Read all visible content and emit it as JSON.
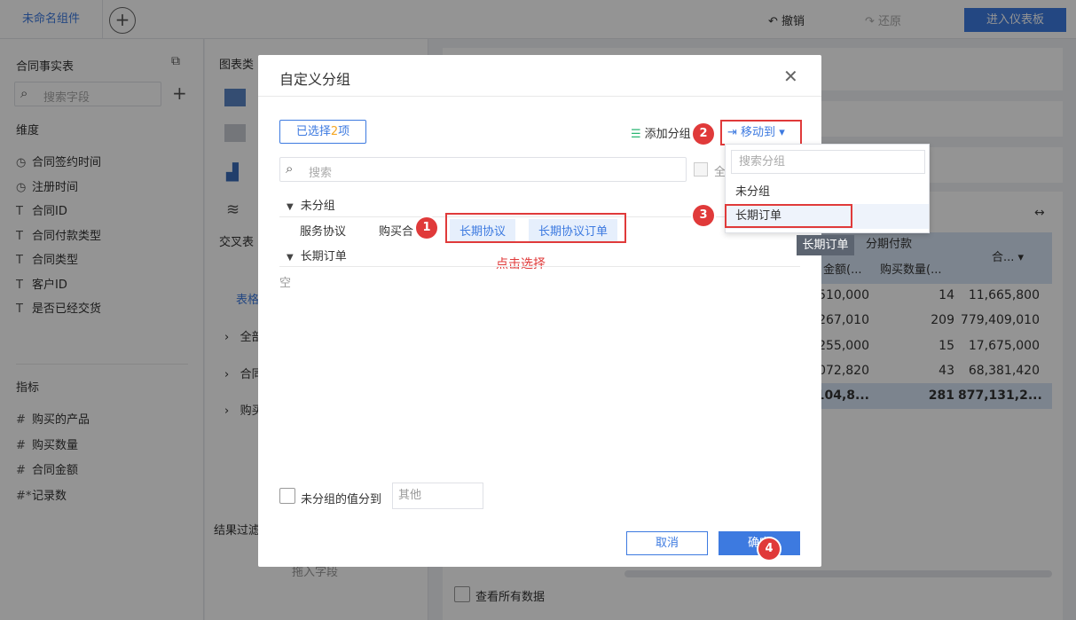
{
  "topbar": {
    "component_name": "未命名组件",
    "add_label": "+",
    "undo_label": "撤销",
    "redo_label": "还原",
    "enter_dashboard_label": "进入仪表板"
  },
  "left_panel": {
    "title": "合同事实表",
    "search_placeholder": "搜索字段",
    "dimension_header": "维度",
    "dimensions": [
      {
        "icon": "clock-icon",
        "glyph": "◷",
        "label": "合同签约时间"
      },
      {
        "icon": "clock-icon",
        "glyph": "◷",
        "label": "注册时间"
      },
      {
        "icon": "text-field-icon",
        "glyph": "T",
        "label": "合同ID"
      },
      {
        "icon": "text-field-icon",
        "glyph": "T",
        "label": "合同付款类型"
      },
      {
        "icon": "text-field-icon",
        "glyph": "T",
        "label": "合同类型"
      },
      {
        "icon": "text-field-icon",
        "glyph": "T",
        "label": "客户ID"
      },
      {
        "icon": "text-field-icon",
        "glyph": "T",
        "label": "是否已经交货"
      }
    ],
    "metric_header": "指标",
    "metrics": [
      {
        "icon": "number-field-icon",
        "glyph": "#",
        "label": "购买的产品"
      },
      {
        "icon": "number-field-icon",
        "glyph": "#",
        "label": "购买数量"
      },
      {
        "icon": "number-field-icon",
        "glyph": "#",
        "label": "合同金额"
      },
      {
        "icon": "record-count-icon",
        "glyph": "#*",
        "label": "记录数"
      }
    ]
  },
  "middle_panel": {
    "chart_type_label": "图表类",
    "cross_table_label": "交叉表",
    "table_label": "表格",
    "rows": [
      "全部",
      "合同",
      "购买"
    ],
    "result_filter_label": "结果过滤",
    "drop_field_label": "拖入字段"
  },
  "background_table": {
    "header_group": "分期付款",
    "columns": [
      "金额(...",
      "购买数量(...",
      "合..."
    ],
    "rows": [
      [
        ",510,000",
        "14",
        "11,665,800"
      ],
      [
        ",267,010",
        "209",
        "779,409,010"
      ],
      [
        ",255,000",
        "15",
        "17,675,000"
      ],
      [
        ",072,820",
        "43",
        "68,381,420"
      ]
    ],
    "total_row": [
      "104,8...",
      "281",
      "877,131,2..."
    ],
    "view_all_label": "查看所有数据"
  },
  "dialog": {
    "title": "自定义分组",
    "selected_prefix": "已选择",
    "selected_count": "2",
    "selected_suffix": "项",
    "add_group_label": "添加分组",
    "move_to_label": "移动到",
    "search_placeholder": "搜索",
    "select_all_label": "全",
    "groups": [
      {
        "name": "未分组",
        "items": [
          "服务协议",
          "购买合",
          "长期协议",
          "长期协议订单"
        ]
      },
      {
        "name": "长期订单",
        "items": []
      }
    ],
    "empty_label": "空",
    "hint_label": "点击选择",
    "ungroup_label": "未分组的值分到",
    "ungroup_value_placeholder": "其他",
    "cancel_label": "取消",
    "confirm_label": "确定"
  },
  "dropdown": {
    "search_placeholder": "搜索分组",
    "options": [
      "未分组",
      "长期订单"
    ],
    "tooltip": "长期订单"
  },
  "badges": [
    "1",
    "2",
    "3",
    "4"
  ],
  "colors": {
    "primary": "#3d7ae0",
    "highlight_red": "#e03a3a",
    "accent_orange": "#f5a623"
  }
}
